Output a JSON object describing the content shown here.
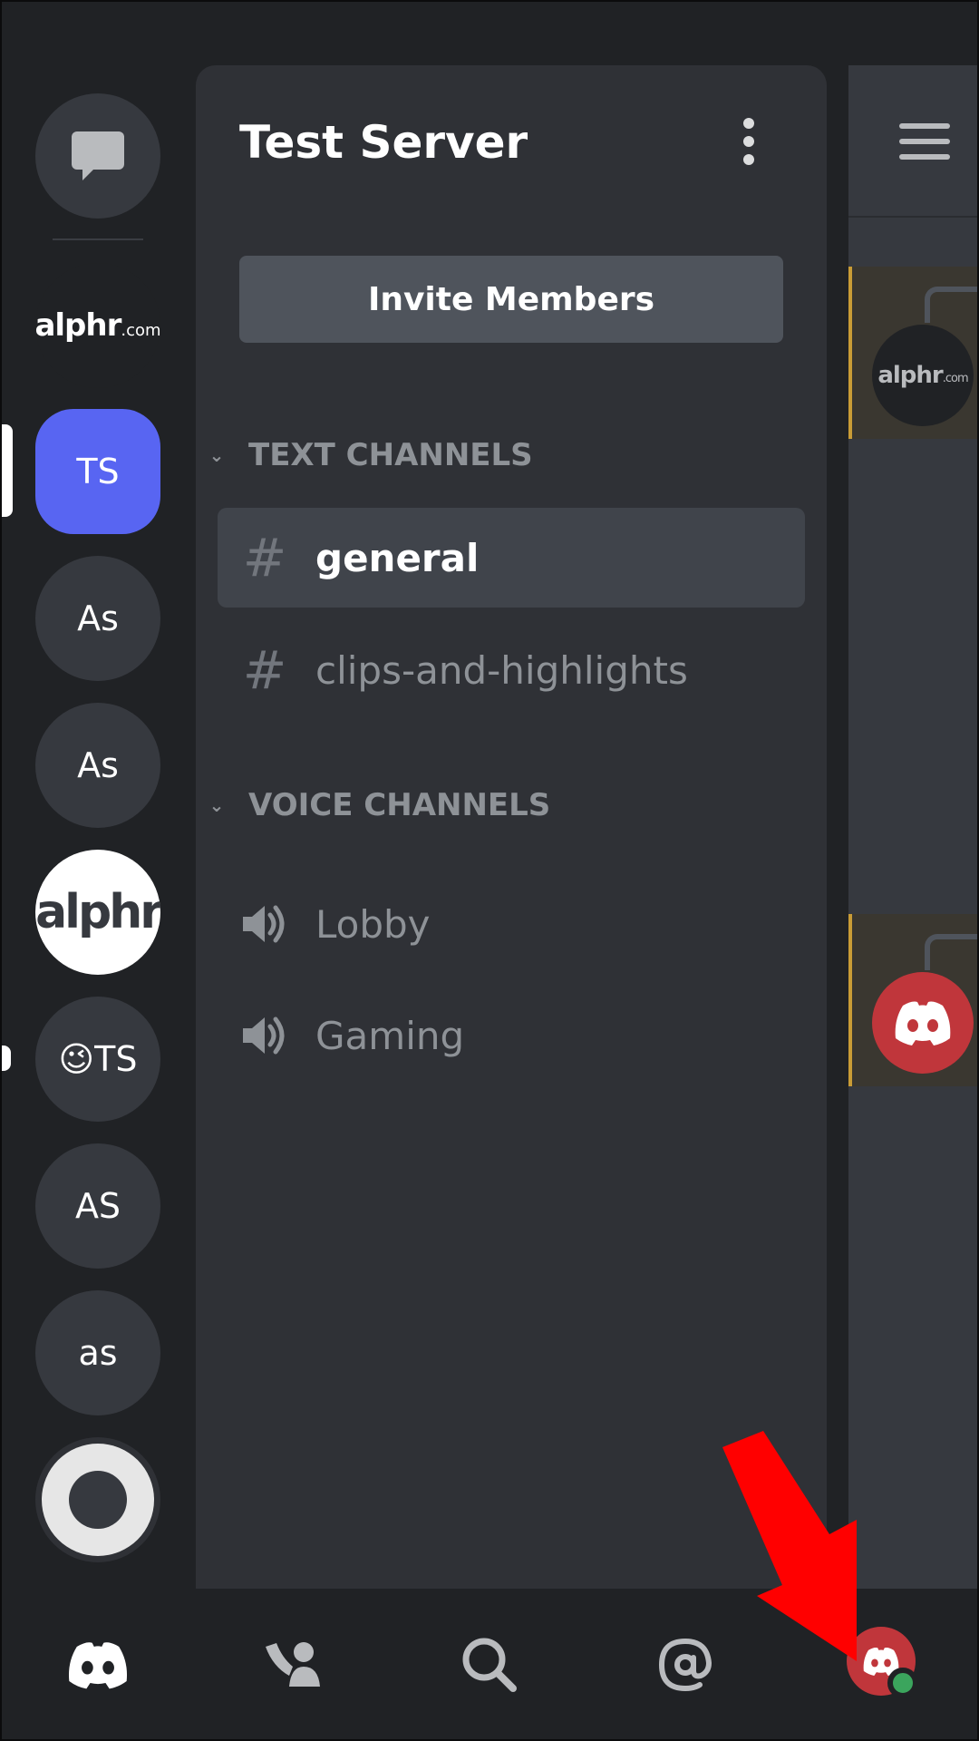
{
  "server": {
    "name": "Test Server",
    "invite_label": "Invite Members"
  },
  "rail": {
    "servers": [
      {
        "key": "dm",
        "label": ""
      },
      {
        "key": "alphr-com",
        "label": "alphr",
        "suffix": ".com"
      },
      {
        "key": "ts",
        "label": "TS"
      },
      {
        "key": "as1",
        "label": "As"
      },
      {
        "key": "as2",
        "label": "As"
      },
      {
        "key": "alphr-white",
        "label": "alphr"
      },
      {
        "key": "wink-ts",
        "label": "😉TS"
      },
      {
        "key": "as-upper",
        "label": "AS"
      },
      {
        "key": "as-lower",
        "label": "as"
      }
    ]
  },
  "categories": {
    "text": "TEXT CHANNELS",
    "voice": "VOICE CHANNELS"
  },
  "text_channels": [
    {
      "name": "general",
      "selected": true
    },
    {
      "name": "clips-and-highlights",
      "selected": false
    }
  ],
  "voice_channels": [
    {
      "name": "Lobby"
    },
    {
      "name": "Gaming"
    }
  ],
  "peek": {
    "avatar_text": "alphr",
    "avatar_suffix": ".com"
  },
  "bottom_nav": [
    "home-icon",
    "friends-icon",
    "search-icon",
    "mentions-icon",
    "profile-avatar"
  ],
  "colors": {
    "blurple": "#5865f2",
    "online": "#3ba55d",
    "profile_red": "#c0363b",
    "annotation_arrow": "#ff0000"
  }
}
